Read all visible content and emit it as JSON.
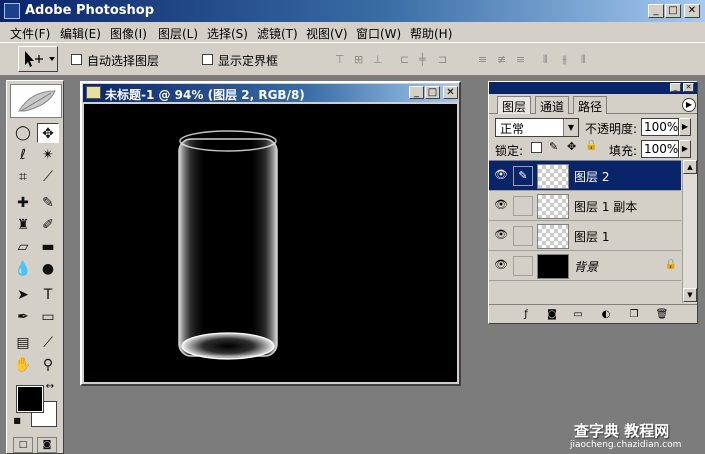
{
  "app": {
    "title": "Adobe Photoshop",
    "titlebar_color": "#0a246a"
  },
  "window_buttons": {
    "minimize": "_",
    "maximize": "□",
    "close": "✕"
  },
  "menu": [
    "文件(F)",
    "编辑(E)",
    "图像(I)",
    "图层(L)",
    "选择(S)",
    "滤镜(T)",
    "视图(V)",
    "窗口(W)",
    "帮助(H)"
  ],
  "options_bar": {
    "auto_select_label": "自动选择图层",
    "show_bounds_label": "显示定界框",
    "align_icons": [
      "align-top-icon",
      "align-vcenter-icon",
      "align-bottom-icon",
      "align-left-icon",
      "align-hcenter-icon",
      "align-right-icon",
      "distribute-top-icon",
      "distribute-vcenter-icon",
      "distribute-bottom-icon",
      "distribute-left-icon",
      "distribute-hcenter-icon",
      "distribute-right-icon"
    ]
  },
  "document": {
    "title": "未标题-1 @ 94% (图层 2, RGB/8)",
    "canvas_color": "#000000"
  },
  "layers_panel": {
    "tabs": [
      "图层",
      "通道",
      "路径"
    ],
    "blend_mode": "正常",
    "opacity_label": "不透明度:",
    "opacity_value": "100%",
    "lock_label": "锁定:",
    "fill_label": "填充:",
    "fill_value": "100%",
    "layers": [
      {
        "name": "图层 2",
        "selected": true,
        "thumb": "transparent"
      },
      {
        "name": "图层 1 副本",
        "selected": false,
        "thumb": "transparent"
      },
      {
        "name": "图层 1",
        "selected": false,
        "thumb": "transparent"
      },
      {
        "name": "背景",
        "selected": false,
        "thumb": "black",
        "locked": true
      }
    ]
  },
  "watermark": {
    "main": "查字典 教程网",
    "sub": "jiaocheng.chazidian.com"
  }
}
